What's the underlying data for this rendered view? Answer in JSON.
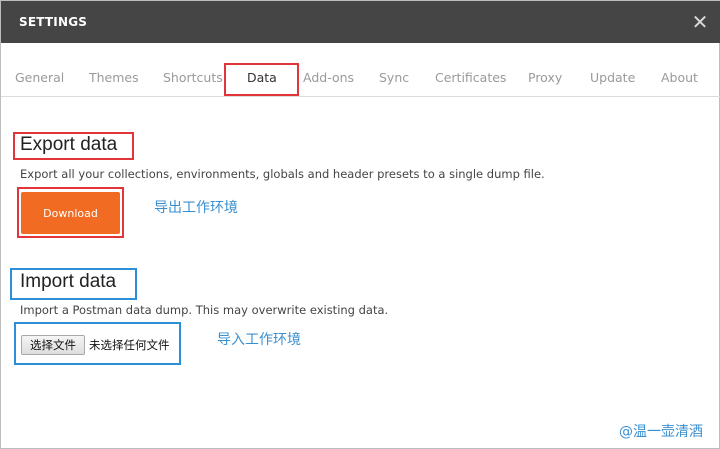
{
  "header": {
    "title": "SETTINGS",
    "close_glyph": "✕",
    "close_icon": "close-icon"
  },
  "tabs": [
    {
      "label": "General"
    },
    {
      "label": "Themes"
    },
    {
      "label": "Shortcuts"
    },
    {
      "label": "Data",
      "active": true
    },
    {
      "label": "Add-ons"
    },
    {
      "label": "Sync"
    },
    {
      "label": "Certificates"
    },
    {
      "label": "Proxy"
    },
    {
      "label": "Update"
    },
    {
      "label": "About"
    }
  ],
  "export": {
    "title": "Export data",
    "description": "Export all your collections, environments, globals and header presets to a single dump file.",
    "button_label": "Download",
    "annotation": "导出工作环境"
  },
  "import": {
    "title": "Import data",
    "description": "Import a Postman data dump. This may overwrite existing data.",
    "file_button_label": "选择文件",
    "file_status": "未选择任何文件",
    "annotation": "导入工作环境"
  },
  "watermark": "@温一壶清酒",
  "colors": {
    "header_bg": "#454545",
    "accent_orange": "#f26b23",
    "annotation_red": "#e3343a",
    "annotation_blue": "#2d8fd6"
  }
}
